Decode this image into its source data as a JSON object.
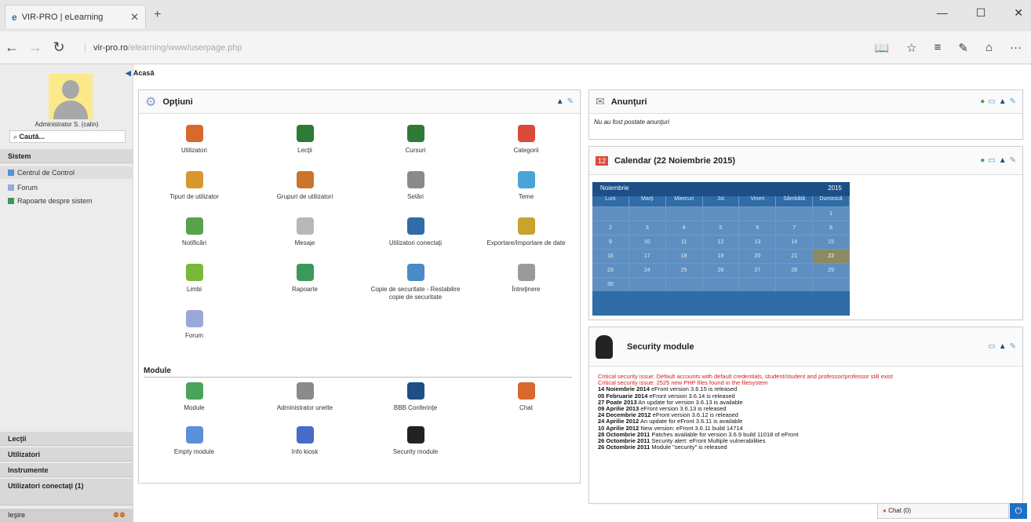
{
  "browser": {
    "tab_title": "VIR-PRO | eLearning",
    "tab_icon": "e-icon",
    "url_host": "vir-pro.ro",
    "url_path": "/elearning/www/userpage.php"
  },
  "sidebar": {
    "user_name": "Administrator S. (calin)",
    "search_placeholder": "Caută...",
    "section_system": "Sistem",
    "items": [
      {
        "label": "Centrul de Control",
        "icon": "control-center-icon"
      },
      {
        "label": "Forum",
        "icon": "forum-icon"
      },
      {
        "label": "Rapoarte despre sistem",
        "icon": "reports-icon"
      }
    ],
    "bottom_sections": [
      "Lecţii",
      "Utilizatori",
      "Instrumente",
      "Utilizatori conectaţi (1)"
    ],
    "logout": "Ieşire"
  },
  "breadcrumb": "Acasă",
  "options_panel": {
    "title": "Opţiuni",
    "items": [
      {
        "label": "Utilizatori",
        "color": "#d9682c"
      },
      {
        "label": "Lecţii",
        "color": "#2f7a38"
      },
      {
        "label": "Cursuri",
        "color": "#2f7a38"
      },
      {
        "label": "Categorii",
        "color": "#d94a3a"
      },
      {
        "label": "Tipuri de utilizator",
        "color": "#d9962c"
      },
      {
        "label": "Grupuri de utilizatori",
        "color": "#c9752c"
      },
      {
        "label": "Setări",
        "color": "#8a8a8a"
      },
      {
        "label": "Teme",
        "color": "#4aa3d9"
      },
      {
        "label": "Notificări",
        "color": "#5aa24a"
      },
      {
        "label": "Mesaje",
        "color": "#b8b8b8"
      },
      {
        "label": "Utilizatori conectaţi",
        "color": "#2f6ca8"
      },
      {
        "label": "Exportare/Importare de date",
        "color": "#c9a32c"
      },
      {
        "label": "Limbi",
        "color": "#79b83a"
      },
      {
        "label": "Rapoarte",
        "color": "#3a9a5a"
      },
      {
        "label": "Copie de securitate - Restabilire copie de securitate",
        "color": "#4a8ac9"
      },
      {
        "label": "Întreţinere",
        "color": "#9a9a9a"
      },
      {
        "label": "Forum",
        "color": "#9aa8d9"
      }
    ],
    "module_header": "Module",
    "modules": [
      {
        "label": "Module",
        "color": "#4aa35a"
      },
      {
        "label": "Administrator unelte",
        "color": "#8a8a8a"
      },
      {
        "label": "BBB Conferinţe",
        "color": "#1d4f86"
      },
      {
        "label": "Chat",
        "color": "#d9682c"
      },
      {
        "label": "Empty module",
        "color": "#5a8fd9"
      },
      {
        "label": "Info kiosk",
        "color": "#4a6ac9"
      },
      {
        "label": "Security module",
        "color": "#222222"
      }
    ]
  },
  "announcements": {
    "title": "Anunţuri",
    "empty_text": "Nu au fost postate anunţuri"
  },
  "calendar": {
    "title": "Calendar (22 Noiembrie 2015)",
    "month": "Noiembrie",
    "year": "2015",
    "weekdays": [
      "Luni",
      "Marţi",
      "Miercuri",
      "Joi",
      "Vineri",
      "Sâmbătă",
      "Duminică"
    ],
    "days": [
      "",
      "",
      "",
      "",
      "",
      "",
      "1",
      "2",
      "3",
      "4",
      "5",
      "6",
      "7",
      "8",
      "9",
      "10",
      "11",
      "12",
      "13",
      "14",
      "15",
      "16",
      "17",
      "18",
      "19",
      "20",
      "21",
      "22",
      "23",
      "24",
      "25",
      "26",
      "27",
      "28",
      "29",
      "30",
      "",
      "",
      "",
      "",
      "",
      ""
    ],
    "today": "22"
  },
  "security": {
    "title": "Security module",
    "critical": [
      "Critical security issue: Default accounts with default credentials, student/student and professor/professor still exist",
      "Critical security issue: 2525 new PHP files found in the filesystem"
    ],
    "news": [
      {
        "date": "14 Noiembrie 2014",
        "text": "eFront version 3.6.15 is released"
      },
      {
        "date": "05 Februarie 2014",
        "text": "eFront version 3.6.14 is released"
      },
      {
        "date": "27 Poate 2013",
        "text": "An update for version 3.6.13 is available"
      },
      {
        "date": "09 Aprilie 2013",
        "text": "eFront version 3.6.13 is released"
      },
      {
        "date": "24 Decembrie 2012",
        "text": "eFront version 3.6.12 is released"
      },
      {
        "date": "24 Aprilie 2012",
        "text": "An update for eFront 3.6.11 is available"
      },
      {
        "date": "10 Aprilie 2012",
        "text": "New version: eFront 3.6.11 build 14714"
      },
      {
        "date": "28 Octombrie 2011",
        "text": "Patches available for version 3.6.9 build 11018 of eFront"
      },
      {
        "date": "26 Octombrie 2011",
        "text": "Security alert: eFront Multiple vulnerabilities"
      },
      {
        "date": "26 Octombrie 2011",
        "text": "Module \"security\" is released"
      }
    ]
  },
  "chat_bar": "Chat (0)"
}
